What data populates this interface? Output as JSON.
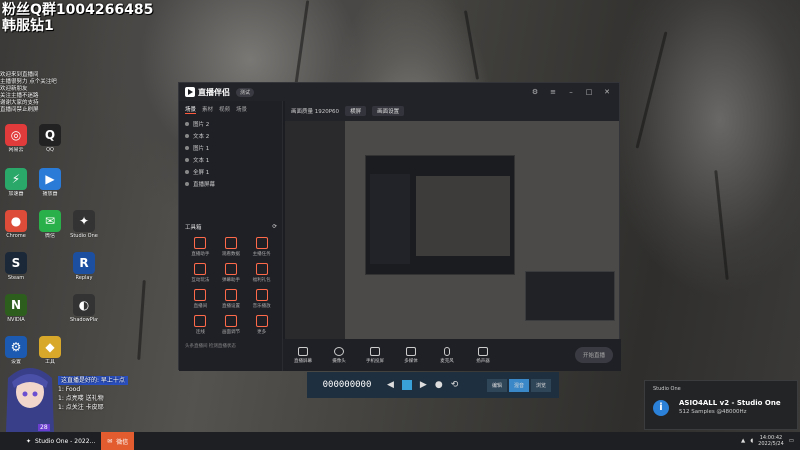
{
  "overlay": {
    "fan_group": "粉丝Q群1004266485",
    "diamond": "韩服钻1"
  },
  "chat": {
    "lines": [
      "欢迎来到直播间",
      "主播很努力 点个关注吧",
      "欢迎新朋友",
      "关注主播不迷路",
      "谢谢大家的支持",
      "直播间禁止刷屏"
    ],
    "bottom": [
      {
        "text": "这直播是好的: 早上十点"
      },
      {
        "text": "1: Food"
      },
      {
        "text": "1: 点亮喽 送礼物"
      },
      {
        "text": "1: 点关注 卡皮耶"
      }
    ],
    "count": "28"
  },
  "desktop_icons": [
    {
      "label": "网易云",
      "color": "#e23b3b",
      "glyph": "◎"
    },
    {
      "label": "QQ",
      "color": "#222222",
      "glyph": "Q"
    },
    {
      "label": "加速器",
      "color": "#2aa86a",
      "glyph": "⚡"
    },
    {
      "label": "播放器",
      "color": "#2a7ad8",
      "glyph": "▶"
    },
    {
      "label": "Chrome",
      "color": "#dd4b39",
      "glyph": "●"
    },
    {
      "label": "微信",
      "color": "#2ab04a",
      "glyph": "✉"
    },
    {
      "label": "Studio One",
      "color": "#333333",
      "glyph": "✦"
    },
    {
      "label": "Steam",
      "color": "#1b2838",
      "glyph": "S"
    },
    {
      "label": "Replay",
      "color": "#1d4fa0",
      "glyph": "R"
    },
    {
      "label": "NVIDIA",
      "color": "#2e5e1e",
      "glyph": "N"
    },
    {
      "label": "ShadowPlay",
      "color": "#333333",
      "glyph": "◐"
    },
    {
      "label": "设置",
      "color": "#1b5ab0",
      "glyph": "⚙"
    },
    {
      "label": "工具",
      "color": "#d8a82a",
      "glyph": "◆"
    }
  ],
  "app": {
    "name": "直播伴侣",
    "badge": "测试",
    "tabs": [
      "场景",
      "素材",
      "视频",
      "场景"
    ],
    "scenes": [
      "图片 2",
      "文本 2",
      "图片 1",
      "文本 1",
      "全屏 1",
      "直播屏幕"
    ],
    "tools_title": "工具箱",
    "tools": [
      "直播助手",
      "观看数据",
      "主播任务",
      "互动玩法",
      "弹幕助手",
      "福利礼包",
      "直播间",
      "直播设置",
      "音乐播放",
      "连线",
      "画面调节",
      "更多"
    ],
    "status_chip_1": "横屏",
    "status_chip_2": "画面设置",
    "status_text": "画面质量 1920P60",
    "footer_hint": "头条直播间 检测直播状态",
    "controls": [
      "直播屏幕",
      "摄像头",
      "手机投屏",
      "多媒体",
      "麦克风",
      "扬声器"
    ],
    "start_label": "开始直播"
  },
  "media": {
    "timecode": "000000000"
  },
  "media_tabs": [
    "编辑",
    "混音",
    "浏览"
  ],
  "notification": {
    "app": "Studio One",
    "title": "ASIO4ALL v2 - Studio One",
    "detail": "512 Samples @48000Hz"
  },
  "taskbar": {
    "items": [
      "Studio One - 2022...",
      "微信"
    ],
    "time": "14:00:42",
    "date": "2022/5/24"
  }
}
